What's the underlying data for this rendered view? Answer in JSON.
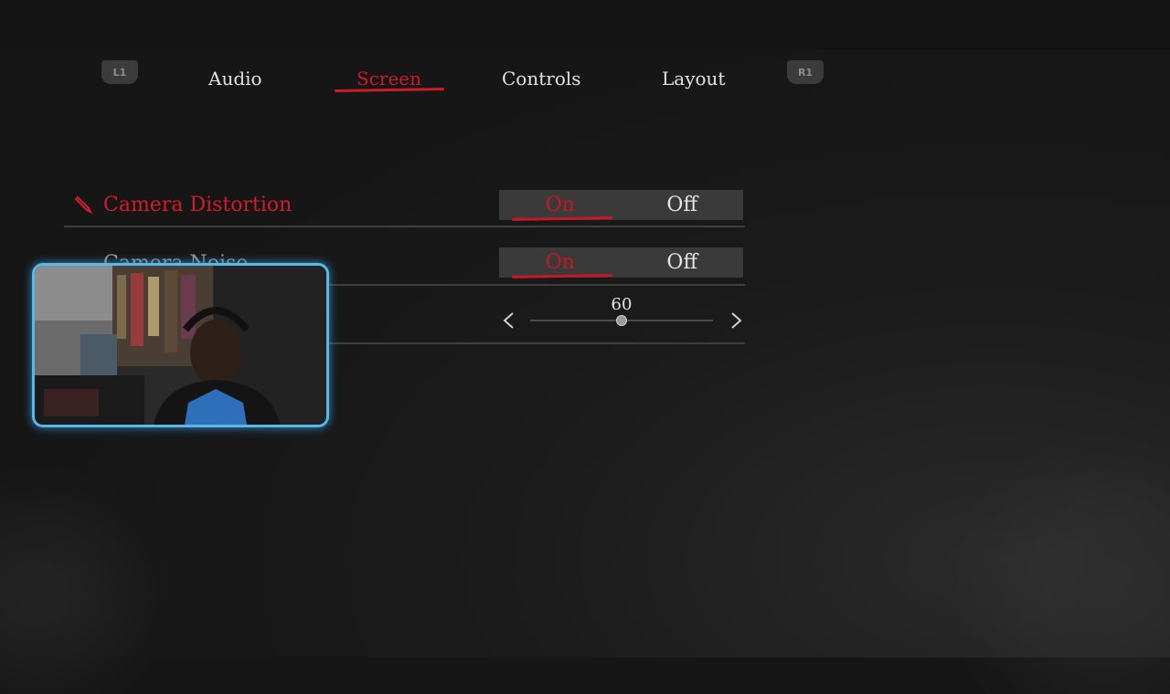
{
  "tabs": {
    "left_shoulder": "L1",
    "right_shoulder": "R1",
    "items": [
      {
        "label": "Audio",
        "active": false
      },
      {
        "label": "Screen",
        "active": true
      },
      {
        "label": "Controls",
        "active": false
      },
      {
        "label": "Layout",
        "active": false
      }
    ]
  },
  "settings": [
    {
      "label": "Camera Distortion",
      "options": [
        "On",
        "Off"
      ],
      "selected": "On",
      "focused": true
    },
    {
      "label": "Camera Noise",
      "options": [
        "On",
        "Off"
      ],
      "selected": "On",
      "focused": false
    },
    {
      "label": "",
      "type": "slider",
      "value": "60",
      "level": 0.5
    }
  ],
  "colors": {
    "accent": "#cf1a2a",
    "webcam_border": "#5ab8e8",
    "background": "#171717"
  },
  "icons": {
    "edit": "pencil-icon",
    "slider_left": "chevron-left-icon",
    "slider_right": "chevron-right-icon"
  }
}
